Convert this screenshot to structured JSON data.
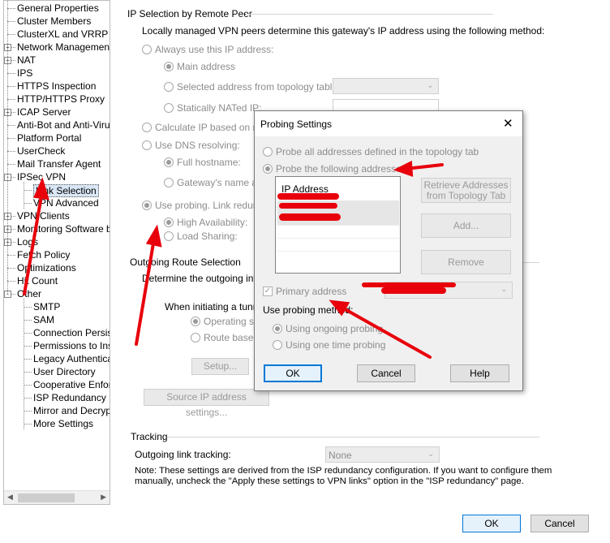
{
  "tree": {
    "items": [
      {
        "label": "General Properties",
        "expander": ""
      },
      {
        "label": "Cluster Members",
        "expander": ""
      },
      {
        "label": "ClusterXL and VRRP",
        "expander": ""
      },
      {
        "label": "Network Management",
        "expander": "+"
      },
      {
        "label": "NAT",
        "expander": "+"
      },
      {
        "label": "IPS",
        "expander": ""
      },
      {
        "label": "HTTPS Inspection",
        "expander": ""
      },
      {
        "label": "HTTP/HTTPS Proxy",
        "expander": ""
      },
      {
        "label": "ICAP Server",
        "expander": "+"
      },
      {
        "label": "Anti-Bot and Anti-Virus",
        "expander": ""
      },
      {
        "label": "Platform Portal",
        "expander": ""
      },
      {
        "label": "UserCheck",
        "expander": ""
      },
      {
        "label": "Mail Transfer Agent",
        "expander": ""
      },
      {
        "label": "IPSec VPN",
        "expander": "-"
      },
      {
        "label": "Link Selection",
        "expander": "",
        "child": true,
        "selected": true
      },
      {
        "label": "VPN Advanced",
        "expander": "",
        "child": true
      },
      {
        "label": "VPN Clients",
        "expander": "+"
      },
      {
        "label": "Monitoring Software bla",
        "expander": "+"
      },
      {
        "label": "Logs",
        "expander": "+"
      },
      {
        "label": "Fetch Policy",
        "expander": ""
      },
      {
        "label": "Optimizations",
        "expander": ""
      },
      {
        "label": "Hit Count",
        "expander": ""
      },
      {
        "label": "Other",
        "expander": "-"
      },
      {
        "label": "SMTP",
        "expander": "",
        "child": true
      },
      {
        "label": "SAM",
        "expander": "",
        "child": true
      },
      {
        "label": "Connection Persist",
        "expander": "",
        "child": true
      },
      {
        "label": "Permissions to Insta",
        "expander": "",
        "child": true
      },
      {
        "label": "Legacy Authenticat",
        "expander": "",
        "child": true
      },
      {
        "label": "User Directory",
        "expander": "",
        "child": true
      },
      {
        "label": "Cooperative Enforc",
        "expander": "",
        "child": true
      },
      {
        "label": "ISP Redundancy",
        "expander": "",
        "child": true
      },
      {
        "label": "Mirror and Decrypt",
        "expander": "",
        "child": true
      },
      {
        "label": "More Settings",
        "expander": "",
        "child": true
      }
    ]
  },
  "ip_selection": {
    "group_title": "IP Selection by Remote Peer",
    "description": "Locally managed VPN peers determine this gateway's IP address using the following method:",
    "always_use": "Always use this IP address:",
    "main_address": "Main address",
    "selected_from_topology": "Selected address from topology table:",
    "statically_nated": "Statically NATed IP:",
    "calculate_ip": "Calculate IP based on net",
    "use_dns": "Use DNS resolving:",
    "full_hostname": "Full hostname:",
    "gateway_name": "Gateway's name and",
    "use_probing": "Use probing. Link redunda",
    "high_availability": "High Availability:",
    "load_sharing": "Load Sharing:"
  },
  "outgoing_route": {
    "group_title": "Outgoing Route Selection",
    "description": "Determine the outgoing interf",
    "when_initiating": "When initiating a tunne",
    "operating_system": "Operating sys",
    "route_based": "Route based",
    "setup_button": "Setup...",
    "source_ip_button": "Source IP address settings..."
  },
  "tracking": {
    "group_title": "Tracking",
    "outgoing_link_tracking": "Outgoing link tracking:",
    "tracking_value": "None",
    "note": "Note: These settings are derived from the ISP redundancy configuration. If you want to configure them",
    "note_line2": "manually, uncheck the \"Apply these settings to VPN links\" option in the \"ISP redundancy\" page."
  },
  "footer": {
    "ok": "OK",
    "cancel": "Cancel"
  },
  "dialog": {
    "title": "Probing Settings",
    "close_glyph": "✕",
    "probe_all": "Probe all addresses defined in the topology tab",
    "probe_following": "Probe the following addresses:",
    "list_header": "IP Address",
    "retrieve_button": "Retrieve Addresses from Topology Tab",
    "add_button": "Add...",
    "remove_button": "Remove",
    "primary_address": "Primary address",
    "use_probing_method": "Use probing method:",
    "ongoing_probing": "Using ongoing probing",
    "one_time_probing": "Using one time probing",
    "ok": "OK",
    "cancel": "Cancel",
    "help": "Help"
  },
  "colors": {
    "annotation_red": "#e8000b",
    "selection_blue": "#d9e6f5",
    "focus_border": "#0078d7"
  }
}
